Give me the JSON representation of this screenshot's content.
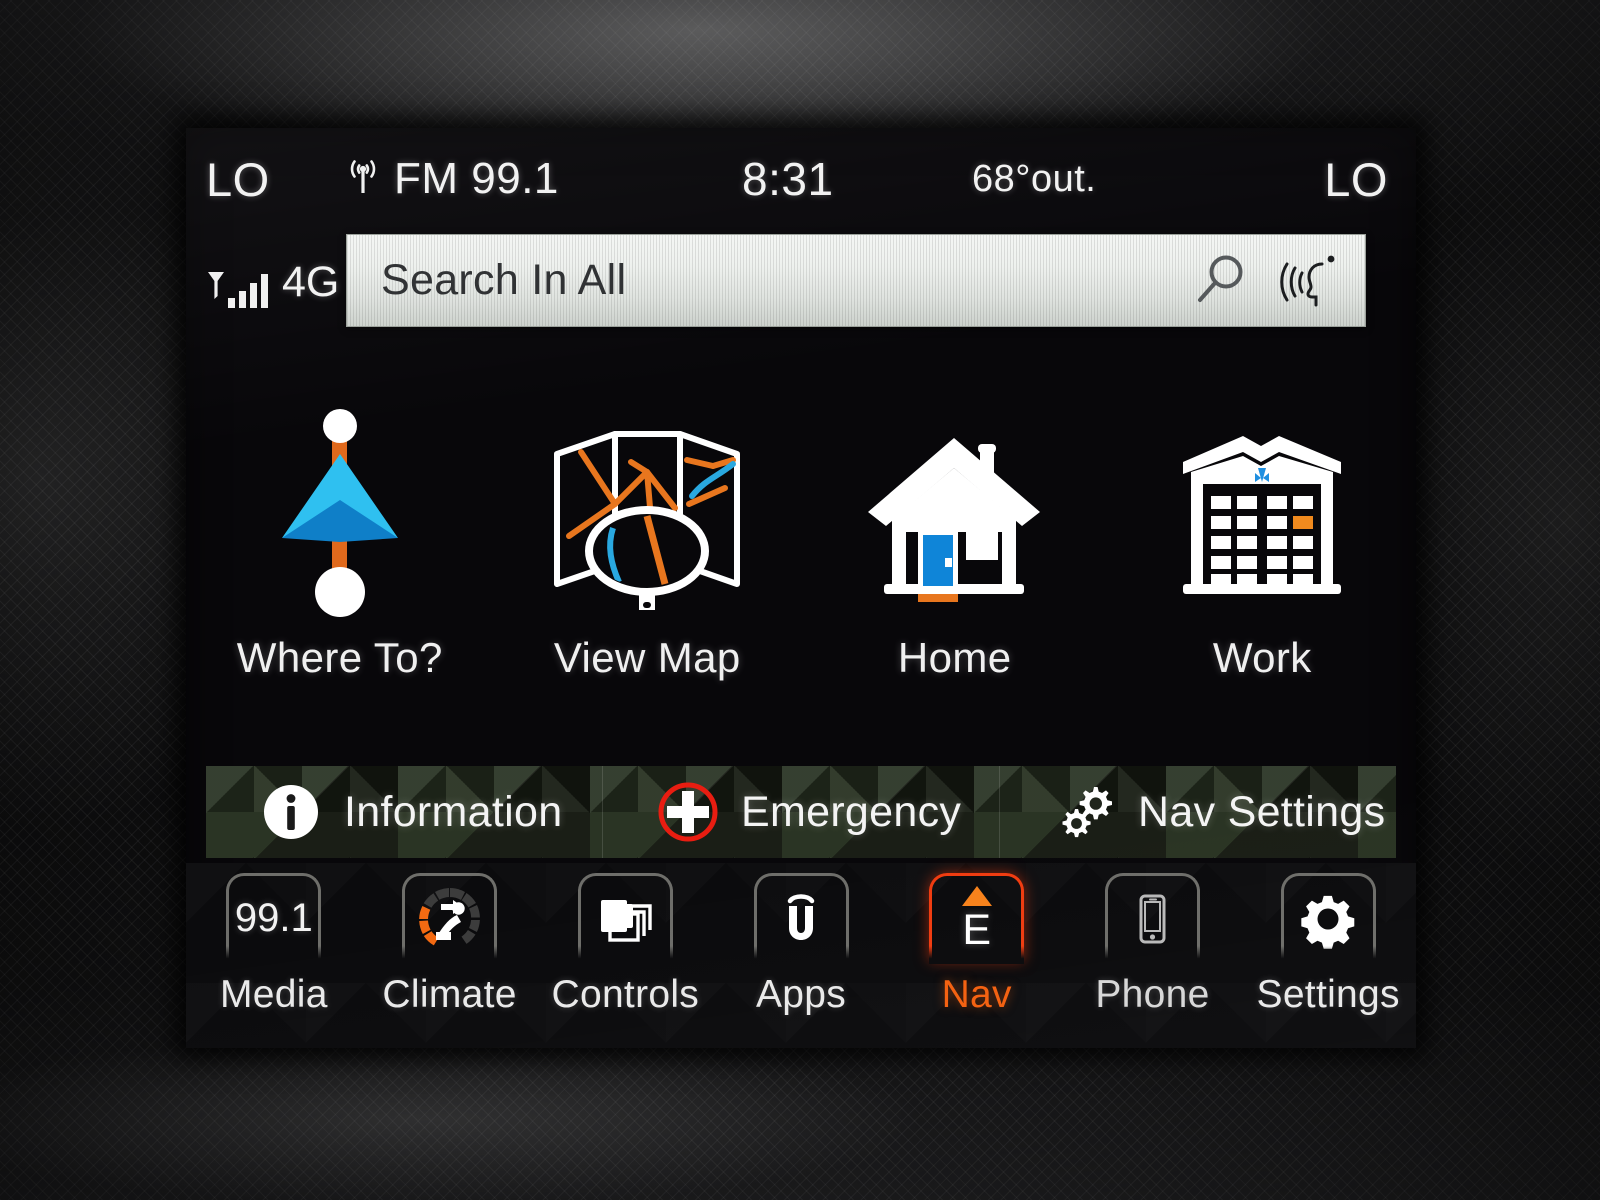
{
  "device": {
    "name": "uconnect-infotainment"
  },
  "status_bar": {
    "temp_left": "LO",
    "temp_right": "LO",
    "radio_icon": "broadcast-tower-icon",
    "radio_source": "FM 99.1",
    "clock": "8:31",
    "outside_temp": "68°out.",
    "signal_icon": "cellular-signal-icon",
    "network": "4G"
  },
  "search": {
    "placeholder": "Search In All",
    "value": "",
    "search_icon": "magnifier-icon",
    "voice_icon": "voice-command-icon"
  },
  "tiles": [
    {
      "id": "where-to",
      "label": "Where To?",
      "icon": "navigation-arrow-icon"
    },
    {
      "id": "view-map",
      "label": "View Map",
      "icon": "folded-map-magnifier-icon"
    },
    {
      "id": "home",
      "label": "Home",
      "icon": "house-icon"
    },
    {
      "id": "work",
      "label": "Work",
      "icon": "office-building-icon"
    }
  ],
  "actions": [
    {
      "id": "information",
      "label": "Information",
      "icon": "info-circle-icon",
      "accent": "#ffffff"
    },
    {
      "id": "emergency",
      "label": "Emergency",
      "icon": "emergency-cross-icon",
      "accent": "#e81d11"
    },
    {
      "id": "nav-settings",
      "label": "Nav Settings",
      "icon": "gears-icon",
      "accent": "#ffffff"
    }
  ],
  "taskbar": [
    {
      "id": "media",
      "label": "Media",
      "icon": "radio-frequency-text",
      "value": "99.1",
      "active": false
    },
    {
      "id": "climate",
      "label": "Climate",
      "icon": "climate-seat-icon",
      "active": false
    },
    {
      "id": "controls",
      "label": "Controls",
      "icon": "stacked-panels-icon",
      "active": false
    },
    {
      "id": "apps",
      "label": "Apps",
      "icon": "uconnect-logo-icon",
      "active": false
    },
    {
      "id": "nav",
      "label": "Nav",
      "icon": "compass-heading-icon",
      "heading": "E",
      "active": true
    },
    {
      "id": "phone",
      "label": "Phone",
      "icon": "smartphone-icon",
      "active": false
    },
    {
      "id": "settings",
      "label": "Settings",
      "icon": "gear-icon",
      "active": false
    }
  ],
  "colors": {
    "accent_orange": "#f4600f",
    "accent_red": "#e81d11",
    "route_orange": "#e8761e",
    "map_blue": "#29a8e0",
    "arrow_cyan": "#29b8e8",
    "arrow_blue": "#0b7ec4",
    "camo_green": "#20251c",
    "screen_black": "#08070a"
  }
}
